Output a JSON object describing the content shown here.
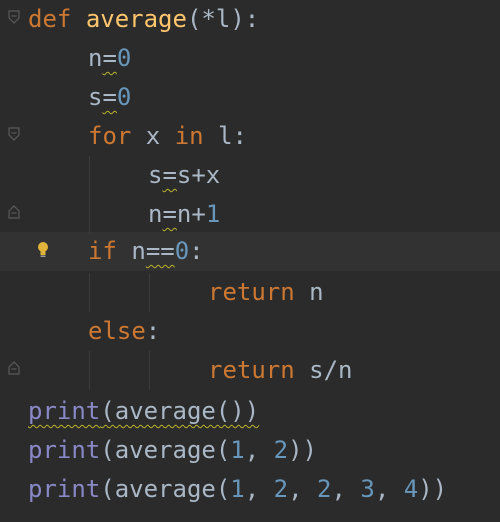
{
  "editor": {
    "theme_colors": {
      "background": "#2b2b2b",
      "keyword": "#cc7832",
      "function_name": "#ffc66d",
      "number": "#6897bb",
      "builtin": "#8888c6",
      "text": "#a9b7c6",
      "warning_underline": "#bbb529",
      "current_line": "#323232"
    },
    "lines": [
      {
        "tokens": [
          "def",
          " ",
          "average",
          "(*l):"
        ]
      },
      {
        "tokens": [
          "n",
          "=",
          "0"
        ]
      },
      {
        "tokens": [
          "s",
          "=",
          "0"
        ]
      },
      {
        "tokens": [
          "for",
          " x ",
          "in",
          " l:"
        ]
      },
      {
        "tokens": [
          "s",
          "=",
          "s+x"
        ]
      },
      {
        "tokens": [
          "n",
          "=",
          "n+",
          "1"
        ]
      },
      {
        "tokens": [
          "if",
          " n",
          "==",
          "0",
          ":"
        ]
      },
      {
        "tokens": [
          "return",
          " n"
        ]
      },
      {
        "tokens": [
          "else",
          ":"
        ]
      },
      {
        "tokens": [
          "return",
          " s/n"
        ]
      },
      {
        "tokens": [
          "print",
          "(average())"
        ]
      },
      {
        "tokens": [
          "print",
          "(average(",
          "1",
          ", ",
          "2",
          "))"
        ]
      },
      {
        "tokens": [
          "print",
          "(average(",
          "1",
          ", ",
          "2",
          ", ",
          "2",
          ", ",
          "3",
          ", ",
          "4",
          "))"
        ]
      }
    ],
    "icons": {
      "fold": "fold-marker-icon",
      "intention": "lightbulb-icon"
    }
  }
}
